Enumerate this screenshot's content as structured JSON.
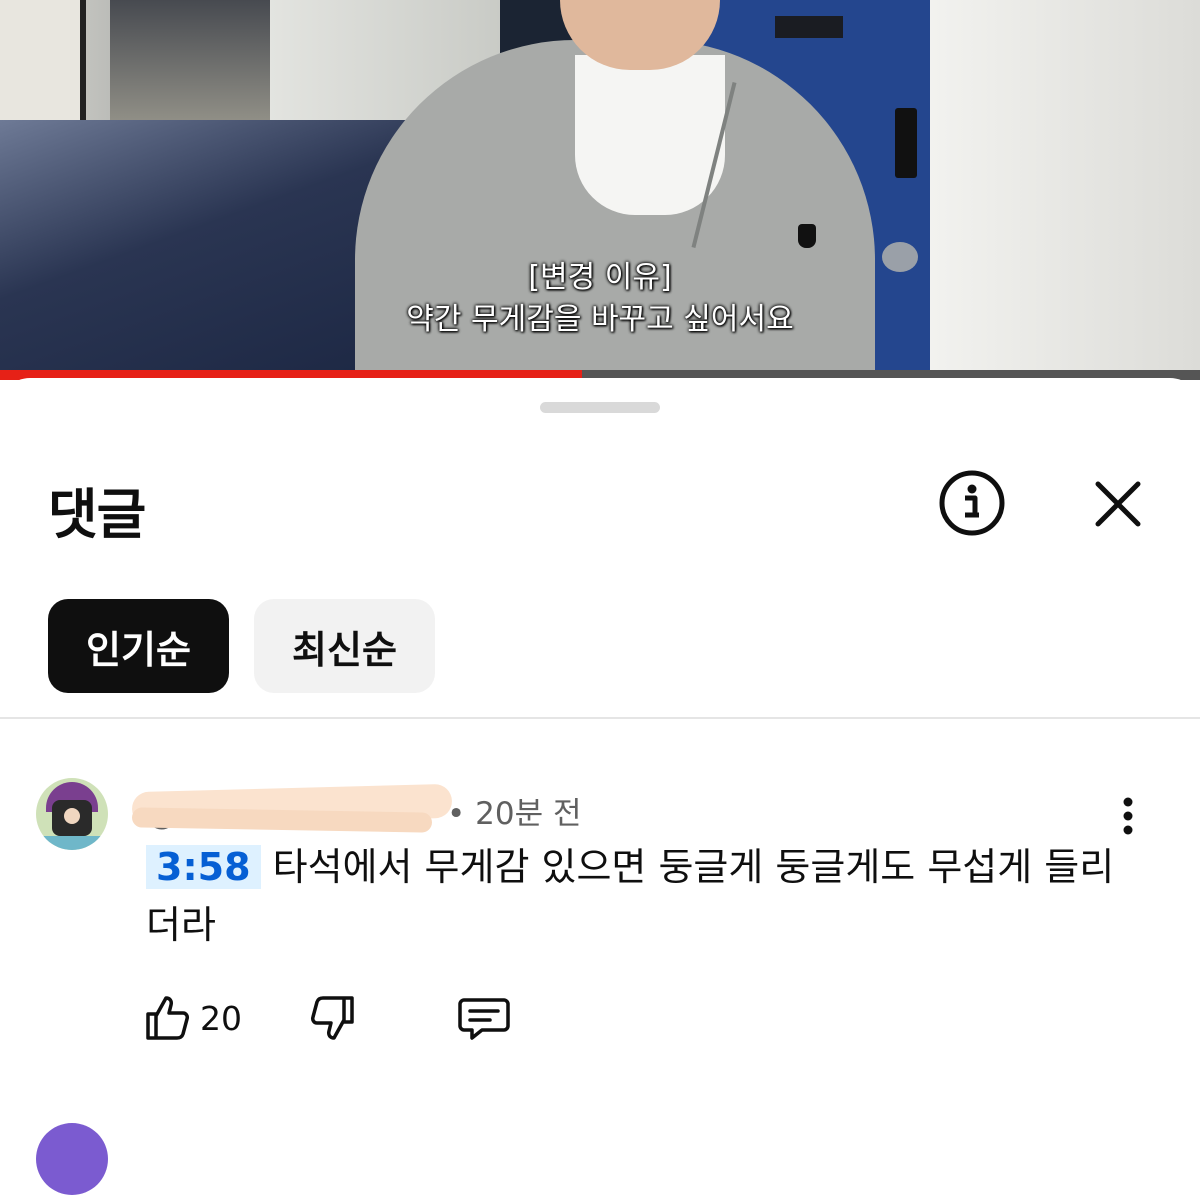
{
  "video": {
    "subtitle_line1": "[변경 이유]",
    "subtitle_line2": "약간 무게감을 바꾸고 싶어서요",
    "progress_fraction": 0.485,
    "accent_color": "#e62117"
  },
  "sheet": {
    "title": "댓글",
    "info_icon": "info-icon",
    "close_icon": "close-icon"
  },
  "sort": {
    "options": [
      {
        "label": "인기순",
        "selected": true
      },
      {
        "label": "최신순",
        "selected": false
      }
    ]
  },
  "comments": [
    {
      "handle": "@",
      "time": "• 20분 전",
      "timestamp": "3:58",
      "text": " 타석에서 무게감 있으면 둥글게 둥글게도 무섭게 들리더라",
      "likes": "20",
      "icons": [
        "like-icon",
        "dislike-icon",
        "reply-icon",
        "more-vert-icon"
      ]
    }
  ]
}
